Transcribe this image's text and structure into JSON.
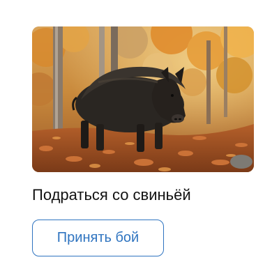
{
  "card": {
    "image_subject": "wild-boar-in-autumn-forest",
    "title": "Подраться со свиньёй",
    "action_button_label": "Принять бой",
    "accent_color": "#2f74c0"
  }
}
